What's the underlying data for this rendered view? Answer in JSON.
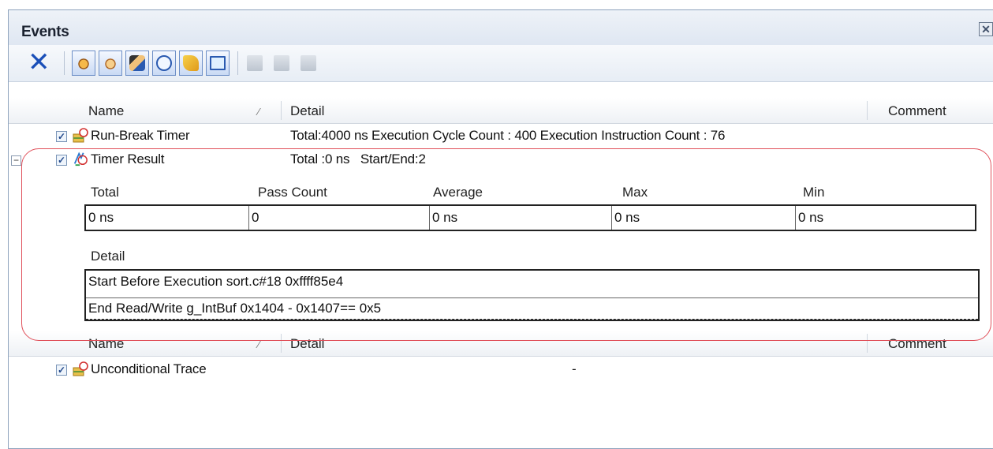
{
  "panel": {
    "title": "Events",
    "close_glyph": "✕"
  },
  "toolbar": {
    "delete_glyph": "✕",
    "buttons": [
      {
        "icon": "hardware-break-icon"
      },
      {
        "icon": "software-break-icon"
      },
      {
        "icon": "trace-event-icon"
      },
      {
        "icon": "timer-event-icon"
      },
      {
        "icon": "event-condition-icon"
      },
      {
        "icon": "display-event-icon"
      }
    ],
    "disabled_buttons": [
      {
        "icon": "edit-condition-icon"
      },
      {
        "icon": "copy-event-icon"
      },
      {
        "icon": "paste-event-icon"
      }
    ]
  },
  "columns": {
    "name": "Name",
    "sort_glyph": "⁄",
    "detail": "Detail",
    "comment": "Comment"
  },
  "events": [
    {
      "name": "Run-Break Timer",
      "checked": "✓",
      "detail": "Total:4000 ns Execution Cycle Count : 400 Execution Instruction Count : 76"
    },
    {
      "name": "Timer Result",
      "checked": "✓",
      "expand_glyph": "−",
      "detail": "Total :0 ns   Start/End:2",
      "result_columns": [
        "Total",
        "Pass Count",
        "Average",
        "Max",
        "Min"
      ],
      "result_values": [
        "0 ns",
        "0",
        "0 ns",
        "0 ns",
        "0 ns"
      ],
      "detail_header": "Detail",
      "detail_rows": [
        "Start Before Execution sort.c#18 0xffff85e4",
        "End Read/Write g_IntBuf 0x1404 - 0x1407== 0x5"
      ]
    }
  ],
  "columns2": {
    "name": "Name",
    "sort_glyph": "⁄",
    "detail": "Detail",
    "comment": "Comment"
  },
  "events2": [
    {
      "name": "Unconditional Trace",
      "checked": "✓",
      "detail": "-"
    }
  ],
  "colors": {
    "highlight": "#e0505a",
    "toolbar_accent": "#1a4fb8"
  }
}
